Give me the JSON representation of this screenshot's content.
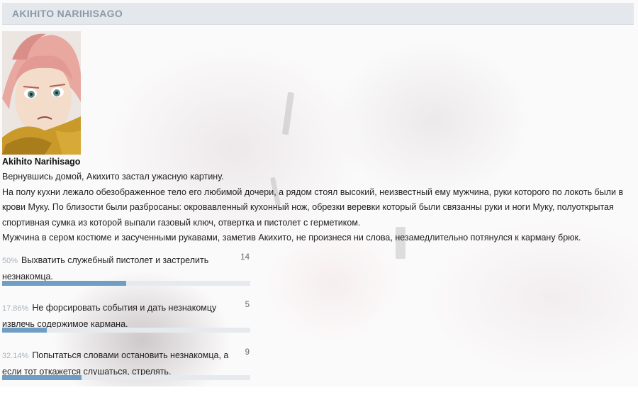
{
  "header": {
    "title": "AKIHITO NARIHISAGO"
  },
  "post": {
    "author": "Akihito Narihisago",
    "paragraphs": [
      "Вернувшись домой, Акихито застал ужасную картину.",
      "На полу кухни лежало обезображенное тело его любимой дочери, а рядом стоял высокий, неизвестный ему мужчина, руки которого по локоть были в крови Муку. По близости были разбросаны: окровавленный кухонный нож, обрезки веревки который были связанны руки и ноги Муку, полуоткрытая спортивная сумка из которой выпали газовый ключ, отвертка и пистолет с герметиком.",
      "Мужчина в сером костюме и засученными рукавами, заметив Акихито, не произнеся ни слова, незамедлительно потянулся к карману брюк."
    ]
  },
  "poll": {
    "bar_color": "#6e9ec6",
    "options": [
      {
        "percent": "50%",
        "fraction": 0.5,
        "text": "Выхватить служебный пистолет и застрелить незнакомца.",
        "votes": "14"
      },
      {
        "percent": "17.86%",
        "fraction": 0.1786,
        "text": "Не форсировать события и дать незнакомцу извлечь содержимое кармана.",
        "votes": "5"
      },
      {
        "percent": "32.14%",
        "fraction": 0.3214,
        "text": "Попытаться словами остановить незнакомца, а если тот откажется слушаться, стрелять.",
        "votes": "9"
      }
    ]
  }
}
